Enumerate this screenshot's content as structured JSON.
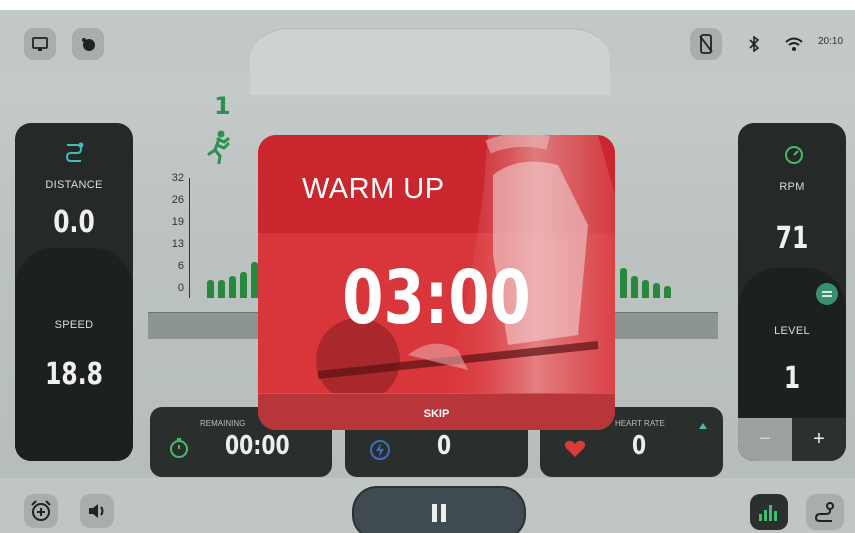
{
  "colors": {
    "accent_green": "#28883e",
    "modal_red": "#d9363b",
    "panel_dark": "#252a29"
  },
  "status_bar": {
    "time": "20:10"
  },
  "runner": {
    "level_number": "1"
  },
  "left_panel": {
    "distance_label": "DISTANCE",
    "distance_value": "0.0",
    "speed_label": "SPEED",
    "speed_value": "18.8"
  },
  "right_panel": {
    "rpm_label": "RPM",
    "rpm_value": "71",
    "level_label": "LEVEL",
    "level_value": "1",
    "minus_label": "−",
    "plus_label": "+"
  },
  "chart": {
    "y_ticks": [
      "32",
      "26",
      "19",
      "13",
      "6",
      "0"
    ]
  },
  "cards": {
    "remaining_label": "REMAINING",
    "remaining_value": "00:00",
    "energy_value": "0",
    "heart_rate_label": "HEART RATE",
    "heart_rate_value": "0"
  },
  "modal": {
    "title": "WARM UP",
    "timer": "03:00",
    "skip_label": "SKIP"
  }
}
